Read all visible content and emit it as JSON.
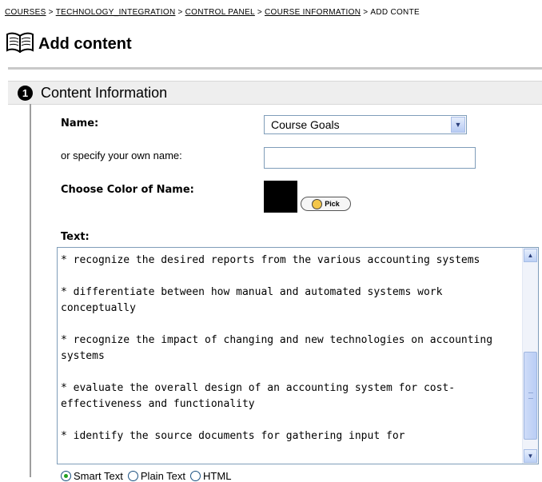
{
  "breadcrumb": {
    "items": [
      "COURSES",
      "TECHNOLOGY_INTEGRATION",
      "CONTROL PANEL",
      "COURSE INFORMATION",
      "ADD CONTE"
    ],
    "separator": ">"
  },
  "page": {
    "title": "Add content",
    "icon": "open-book-icon"
  },
  "section": {
    "number": "1",
    "title": "Content Information"
  },
  "form": {
    "name_label": "Name:",
    "name_select_value": "Course Goals",
    "custom_name_label": "or specify your own name:",
    "custom_name_value": "",
    "color_label": "Choose Color of Name:",
    "color_value": "#000000",
    "pick_button_label": "Pick",
    "text_label": "Text:",
    "text_value": "* recognize the desired reports from the various accounting systems\n\n* differentiate between how manual and automated systems work conceptually\n\n* recognize the impact of changing and new technologies on accounting systems\n\n* evaluate the overall design of an accounting system for cost-effectiveness and functionality\n\n* identify the source documents for gathering input for",
    "format_options": [
      {
        "label": "Smart Text",
        "selected": true
      },
      {
        "label": "Plain Text",
        "selected": false
      },
      {
        "label": "HTML",
        "selected": false
      }
    ]
  },
  "colors": {
    "link": "#000000",
    "section_bg": "#eeeeee",
    "input_border": "#7f9db9"
  }
}
